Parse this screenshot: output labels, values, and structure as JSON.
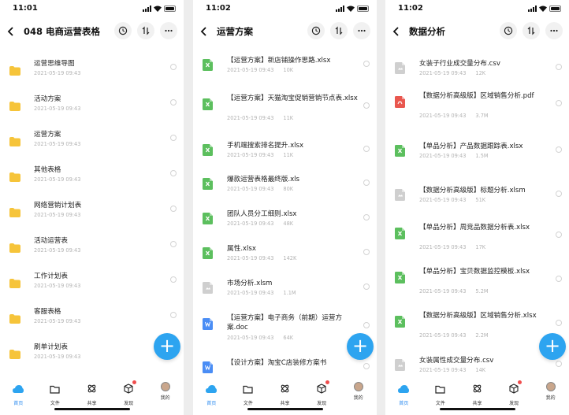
{
  "phones": [
    {
      "time": "11:01",
      "title": "048 电商运营表格",
      "files": [
        {
          "name": "运营思维导图",
          "date": "2021-05-19 09:43",
          "size": "",
          "type": "folder"
        },
        {
          "name": "活动方案",
          "date": "2021-05-19 09:43",
          "size": "",
          "type": "folder"
        },
        {
          "name": "运营方案",
          "date": "2021-05-19 09:43",
          "size": "",
          "type": "folder"
        },
        {
          "name": "其他表格",
          "date": "2021-05-19 09:43",
          "size": "",
          "type": "folder"
        },
        {
          "name": "网络营销计划表",
          "date": "2021-05-19 09:43",
          "size": "",
          "type": "folder"
        },
        {
          "name": "活动运营表",
          "date": "2021-05-19 09:43",
          "size": "",
          "type": "folder"
        },
        {
          "name": "工作计划表",
          "date": "2021-05-19 09:43",
          "size": "",
          "type": "folder"
        },
        {
          "name": "客服表格",
          "date": "2021-05-19 09:43",
          "size": "",
          "type": "folder"
        },
        {
          "name": "刷单计划表",
          "date": "2021-05-19 09:43",
          "size": "",
          "type": "folder"
        }
      ]
    },
    {
      "time": "11:02",
      "title": "运营方案",
      "files": [
        {
          "name": "【运营方案】新店铺操作思路.xlsx",
          "date": "2021-05-19 09:43",
          "size": "10K",
          "type": "xlsx"
        },
        {
          "name": "【运营方案】天猫淘宝促销营销节点表.xlsx",
          "date": "2021-05-19 09:43",
          "size": "11K",
          "type": "xlsx"
        },
        {
          "name": "手机端搜索排名提升.xlsx",
          "date": "2021-05-19 09:43",
          "size": "11K",
          "type": "xlsx"
        },
        {
          "name": "爆款运营表格最终版.xls",
          "date": "2021-05-19 09:43",
          "size": "80K",
          "type": "xlsx"
        },
        {
          "name": "团队人员分工细则.xlsx",
          "date": "2021-05-19 09:43",
          "size": "48K",
          "type": "xlsx"
        },
        {
          "name": "属性.xlsx",
          "date": "2021-05-19 09:43",
          "size": "142K",
          "type": "xlsx"
        },
        {
          "name": "市场分析.xlsm",
          "date": "2021-05-19 09:43",
          "size": "1.1M",
          "type": "other"
        },
        {
          "name": "【运营方案】电子商务（前期）运营方案.doc",
          "date": "2021-05-19 09:43",
          "size": "64K",
          "type": "doc"
        },
        {
          "name": "【设计方案】淘宝C店装修方案书",
          "date": "",
          "size": "",
          "type": "doc"
        }
      ]
    },
    {
      "time": "11:02",
      "title": "数据分析",
      "files": [
        {
          "name": "女装子行业成交量分布.csv",
          "date": "2021-05-19 09:43",
          "size": "12K",
          "type": "other"
        },
        {
          "name": "【数据分析高级版】区域销售分析.pdf",
          "date": "2021-05-19 09:43",
          "size": "3.7M",
          "type": "pdf"
        },
        {
          "name": "【单品分析】产品数据跟踪表.xlsx",
          "date": "2021-05-19 09:43",
          "size": "1.5M",
          "type": "xlsx"
        },
        {
          "name": "【数据分析高级版】标题分析.xlsm",
          "date": "2021-05-19 09:43",
          "size": "51K",
          "type": "other"
        },
        {
          "name": "【单品分析】周竞品数据分析表.xlsx",
          "date": "2021-05-19 09:43",
          "size": "17K",
          "type": "xlsx"
        },
        {
          "name": "【单品分析】宝贝数据监控模板.xlsx",
          "date": "2021-05-19 09:43",
          "size": "5.2M",
          "type": "xlsx"
        },
        {
          "name": "【数据分析高级版】区域销售分析.xlsx",
          "date": "2021-05-19 09:43",
          "size": "2.2M",
          "type": "xlsx"
        },
        {
          "name": "女装属性成交量分布.csv",
          "date": "2021-05-19 09:43",
          "size": "14K",
          "type": "other"
        }
      ]
    }
  ],
  "tabs": [
    "首页",
    "文件",
    "共享",
    "发现",
    "我的"
  ],
  "colors": {
    "accent": "#2da4f0",
    "folder": "#f6c43a",
    "xlsx": "#5cbf5e",
    "pdf": "#e9574f",
    "doc": "#4a8df5",
    "other": "#cfcfcf"
  }
}
